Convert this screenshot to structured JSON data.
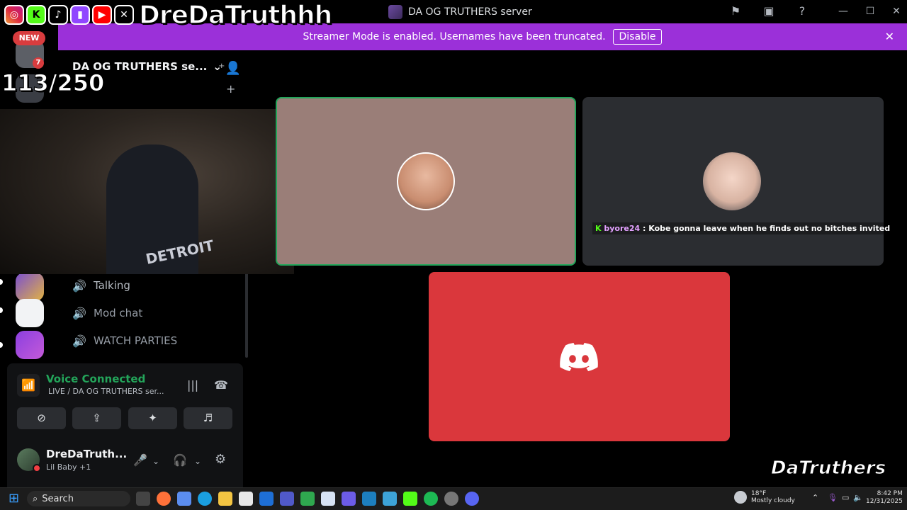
{
  "window": {
    "title": "DA OG TRUTHERS server",
    "icons": [
      "flag-icon",
      "inbox-icon",
      "help-icon"
    ],
    "controls": [
      "minimize",
      "maximize",
      "close"
    ]
  },
  "overlay": {
    "brand_name": "DreDaTruthhh",
    "social_icons": [
      "instagram-icon",
      "kick-icon",
      "tiktok-icon",
      "twitch-icon",
      "youtube-icon",
      "x-icon"
    ],
    "new_badge": "NEW",
    "counter": "113/250",
    "watermark": "DaTruthers",
    "webcam_shirt_text": "DETROIT"
  },
  "banner": {
    "message": "Streamer Mode is enabled. Usernames have been truncated.",
    "button": "Disable"
  },
  "rail": {
    "mention_count": "7"
  },
  "sidebar": {
    "server_name": "DA OG TRUTHERS se...",
    "channels": [
      {
        "name": "Talking",
        "emoji": "🗣"
      },
      {
        "name": "Mod chat",
        "emoji": ""
      },
      {
        "name": "WATCH PARTIES",
        "emoji": ""
      }
    ]
  },
  "voice": {
    "status": "Voice Connected",
    "channel": "LIVE / DA OG TRUTHERS ser...",
    "buttons": [
      "camera-off",
      "screen-share",
      "activities",
      "soundboard"
    ]
  },
  "user": {
    "name": "DreDaTruth...",
    "status": "Lil Baby +1"
  },
  "call": {
    "chat_user": "byore24",
    "chat_message": ": Kobe gonna leave when he finds out no bitches invited"
  },
  "taskbar": {
    "search_placeholder": "Search",
    "weather_temp": "18°F",
    "weather_desc": "Mostly cloudy",
    "time": "8:42 PM",
    "date": "12/31/2025"
  },
  "colors": {
    "banner": "#9b30d9",
    "voice_green": "#23a55a",
    "discord_red": "#da373c",
    "speaking_border": "#23a55a"
  }
}
